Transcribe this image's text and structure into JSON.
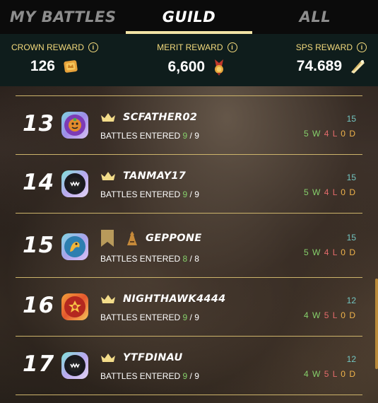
{
  "tabs": [
    {
      "label": "MY BATTLES",
      "active": false
    },
    {
      "label": "GUILD",
      "active": true
    },
    {
      "label": "ALL",
      "active": false
    }
  ],
  "rewards": [
    {
      "title": "CROWN REWARD",
      "value": "126",
      "icon": "crown-token-icon"
    },
    {
      "title": "MERIT REWARD",
      "value": "6,600",
      "icon": "merit-icon"
    },
    {
      "title": "SPS REWARD",
      "value": "74.689",
      "icon": "sps-token-icon"
    }
  ],
  "info_glyph": "i",
  "battles_label": "BATTLES ENTERED",
  "players": [
    {
      "rank": "13",
      "name": "SCFATHER02",
      "badge": "crown-icon",
      "entered": "9",
      "total": "9",
      "rating": "15",
      "wins": "5",
      "losses": "4",
      "draws": "0"
    },
    {
      "rank": "14",
      "name": "TANMAY17",
      "badge": "crown-icon",
      "entered": "9",
      "total": "9",
      "rating": "15",
      "wins": "5",
      "losses": "4",
      "draws": "0"
    },
    {
      "rank": "15",
      "name": "GEPPONE",
      "badge": "banner-icon",
      "entered": "8",
      "total": "8",
      "rating": "15",
      "wins": "5",
      "losses": "4",
      "draws": "0"
    },
    {
      "rank": "16",
      "name": "NIGHTHAWK4444",
      "badge": "crown-icon",
      "entered": "9",
      "total": "9",
      "rating": "12",
      "wins": "4",
      "losses": "5",
      "draws": "0"
    },
    {
      "rank": "17",
      "name": "YTFDINAU",
      "badge": "crown-icon",
      "entered": "9",
      "total": "9",
      "rating": "12",
      "wins": "4",
      "losses": "5",
      "draws": "0"
    }
  ],
  "record_letters": {
    "w": "W",
    "l": "L",
    "d": "D"
  },
  "colors": {
    "accent": "#f2e3a5",
    "reward_title": "#f3da7c",
    "rewards_bg": "#0f1d1c",
    "win": "#86d06b",
    "loss": "#e36b6b",
    "draw": "#f0b34a",
    "rating": "#73c6c2"
  }
}
